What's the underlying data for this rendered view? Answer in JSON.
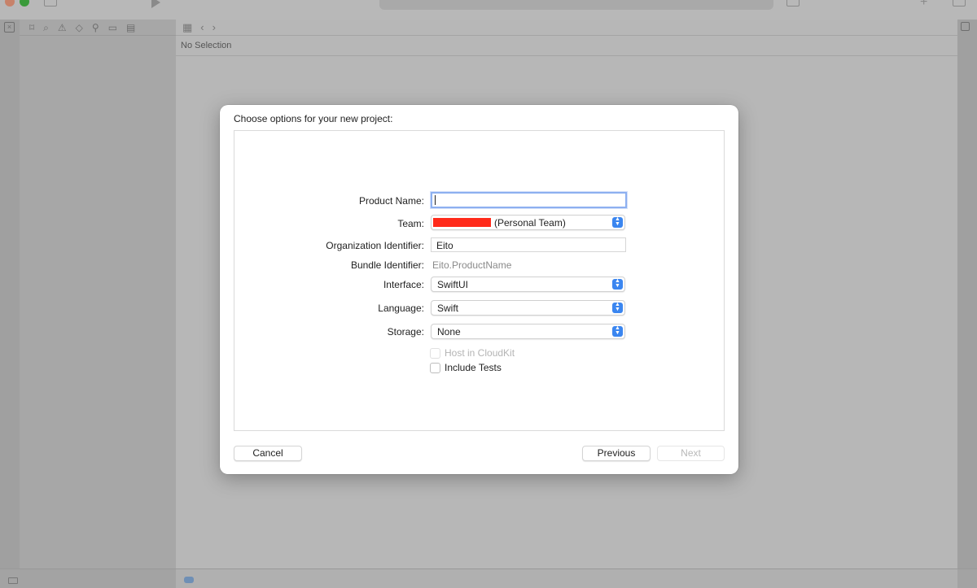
{
  "window": {
    "status_text": "No Selection"
  },
  "sheet": {
    "title": "Choose options for your new project:",
    "fields": {
      "product_name": {
        "label": "Product Name:",
        "value": ""
      },
      "team": {
        "label": "Team:",
        "value": "(Personal Team)"
      },
      "organization_identifier": {
        "label": "Organization Identifier:",
        "value": "Eito"
      },
      "bundle_identifier": {
        "label": "Bundle Identifier:",
        "value": "Eito.ProductName"
      },
      "interface": {
        "label": "Interface:",
        "value": "SwiftUI"
      },
      "language": {
        "label": "Language:",
        "value": "Swift"
      },
      "storage": {
        "label": "Storage:",
        "value": "None"
      }
    },
    "checkboxes": {
      "host_in_cloudkit": {
        "label": "Host in CloudKit",
        "checked": false,
        "enabled": false
      },
      "include_tests": {
        "label": "Include Tests",
        "checked": false,
        "enabled": true
      }
    },
    "buttons": {
      "cancel": "Cancel",
      "previous": "Previous",
      "next": "Next"
    }
  },
  "colors": {
    "accent": "#3b86f0",
    "focus_ring": "#8db0f0",
    "redaction": "#ff2a1a"
  }
}
